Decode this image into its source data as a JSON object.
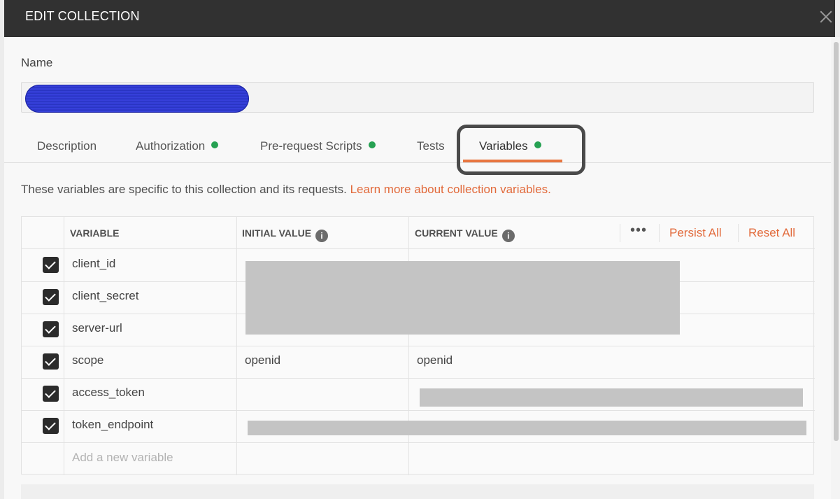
{
  "modal": {
    "title": "EDIT COLLECTION",
    "close_icon": "close-icon"
  },
  "name_field": {
    "label": "Name",
    "value": ""
  },
  "tabs": [
    {
      "label": "Description",
      "has_dot": false,
      "active": false
    },
    {
      "label": "Authorization",
      "has_dot": true,
      "active": false
    },
    {
      "label": "Pre-request Scripts",
      "has_dot": true,
      "active": false
    },
    {
      "label": "Tests",
      "has_dot": false,
      "active": false
    },
    {
      "label": "Variables",
      "has_dot": true,
      "active": true
    }
  ],
  "colors": {
    "accent": "#e26a3b",
    "dot_green": "#26a152",
    "header_bg": "#313131"
  },
  "info": {
    "text": "These variables are specific to this collection and its requests.",
    "link": "Learn more about collection variables."
  },
  "table": {
    "headers": {
      "variable": "VARIABLE",
      "initial_value": "INITIAL VALUE",
      "current_value": "CURRENT VALUE",
      "more": "•••",
      "persist_all": "Persist All",
      "reset_all": "Reset All"
    },
    "rows": [
      {
        "name": "client_id",
        "checked": true,
        "initial": "",
        "current": ""
      },
      {
        "name": "client_secret",
        "checked": true,
        "initial": "",
        "current": ""
      },
      {
        "name": "server-url",
        "checked": true,
        "initial": "",
        "current": ""
      },
      {
        "name": "scope",
        "checked": true,
        "initial": "openid",
        "current": "openid"
      },
      {
        "name": "access_token",
        "checked": true,
        "initial": "",
        "current": ""
      },
      {
        "name": "token_endpoint",
        "checked": true,
        "initial": "",
        "current": ""
      }
    ],
    "new_placeholder": "Add a new variable"
  }
}
